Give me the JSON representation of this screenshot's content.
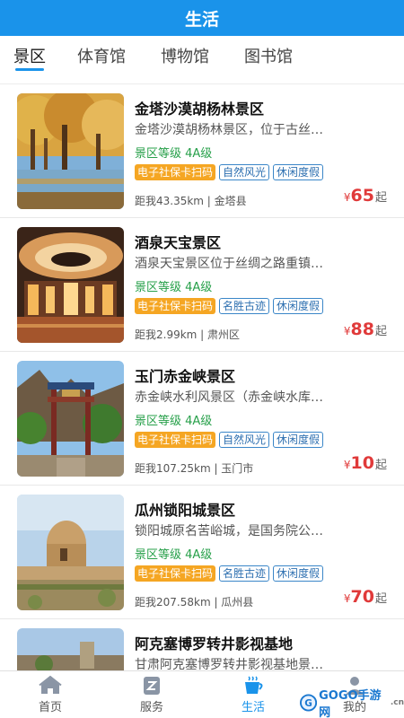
{
  "header": {
    "title": "生活"
  },
  "tabs": [
    {
      "label": "景区",
      "active": true
    },
    {
      "label": "体育馆",
      "active": false
    },
    {
      "label": "博物馆",
      "active": false
    },
    {
      "label": "图书馆",
      "active": false
    }
  ],
  "colors": {
    "primary": "#1a93ea",
    "level_green": "#27a04a",
    "tag_orange": "#f5a623",
    "tag_blue": "#3a86c8",
    "price_red": "#e03a3a"
  },
  "currency_symbol": "¥",
  "price_suffix": "起",
  "items": [
    {
      "title": "金塔沙漠胡杨林景区",
      "desc": "金塔沙漠胡杨林景区，位于古丝…",
      "level": "景区等级 4A级",
      "tags": [
        "电子社保卡扫码",
        "自然风光",
        "休闲度假"
      ],
      "distance": "距我43.35km | 金塔县",
      "price": "65",
      "image": "autumn-poplar-forest-photo"
    },
    {
      "title": "酒泉天宝景区",
      "desc": "酒泉天宝景区位于丝绸之路重镇…",
      "level": "景区等级 4A级",
      "tags": [
        "电子社保卡扫码",
        "名胜古迹",
        "休闲度假"
      ],
      "distance": "距我2.99km | 肃州区",
      "price": "88",
      "image": "illuminated-hall-photo"
    },
    {
      "title": "玉门赤金峡景区",
      "desc": "赤金峡水利风景区（赤金峡水库…",
      "level": "景区等级 4A级",
      "tags": [
        "电子社保卡扫码",
        "自然风光",
        "休闲度假"
      ],
      "distance": "距我107.25km | 玉门市",
      "price": "10",
      "image": "gate-archway-photo"
    },
    {
      "title": "瓜州锁阳城景区",
      "desc": "锁阳城原名苦峪城，是国务院公…",
      "level": "景区等级 4A级",
      "tags": [
        "电子社保卡扫码",
        "名胜古迹",
        "休闲度假"
      ],
      "distance": "距我207.58km | 瓜州县",
      "price": "70",
      "image": "ancient-earthen-ruins-photo"
    },
    {
      "title": "阿克塞博罗转井影视基地",
      "desc": "甘肃阿克塞博罗转井影视基地景…",
      "image": "film-base-ruins-photo"
    }
  ],
  "bottom_nav": [
    {
      "label": "首页",
      "icon": "home-icon",
      "active": false
    },
    {
      "label": "服务",
      "icon": "service-icon",
      "active": false
    },
    {
      "label": "生活",
      "icon": "coffee-cup-icon",
      "active": true
    },
    {
      "label": "我的",
      "icon": "user-icon",
      "active": false
    }
  ],
  "watermark": {
    "text": "GOGO手游网",
    "domain": ".cn"
  }
}
